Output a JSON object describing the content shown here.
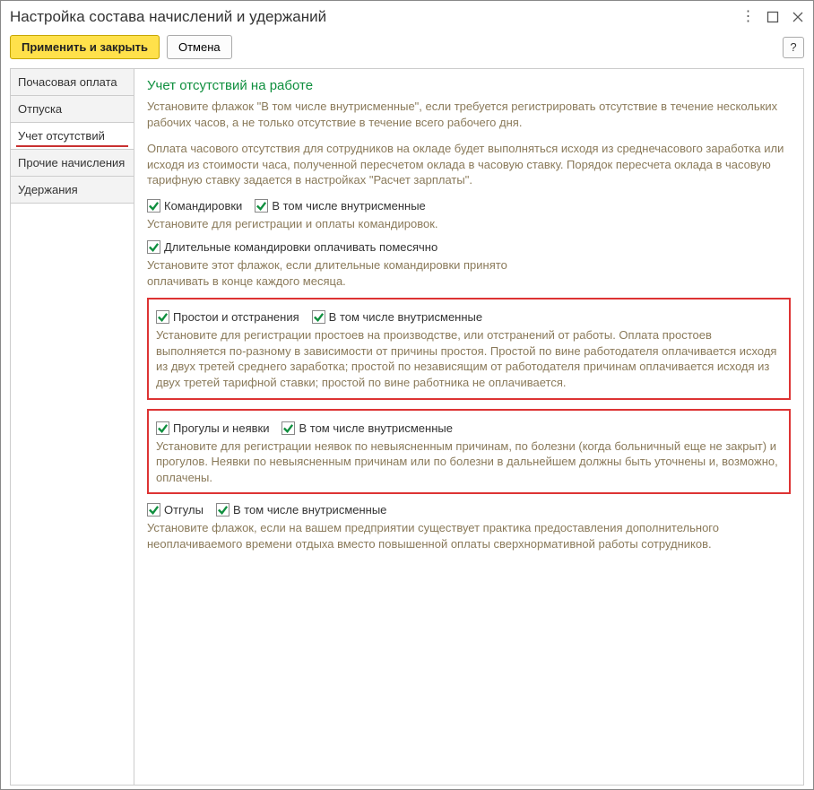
{
  "window": {
    "title": "Настройка состава начислений и удержаний"
  },
  "toolbar": {
    "apply_close": "Применить и закрыть",
    "cancel": "Отмена",
    "help": "?"
  },
  "sidebar": {
    "tabs": [
      {
        "label": "Почасовая оплата",
        "active": false
      },
      {
        "label": "Отпуска",
        "active": false
      },
      {
        "label": "Учет отсутствий",
        "active": true
      },
      {
        "label": "Прочие начисления",
        "active": false
      },
      {
        "label": "Удержания",
        "active": false
      }
    ]
  },
  "content": {
    "heading": "Учет отсутствий на работе",
    "intro1": "Установите флажок \"В том числе внутрисменные\", если требуется регистрировать отсутствие в течение нескольких рабочих часов, а не только отсутствие в течение всего рабочего дня.",
    "intro2": "Оплата часового отсутствия для сотрудников на окладе будет выполняться исходя из среднечасового заработка или исходя из стоимости часа, полученной пересчетом оклада в часовую ставку. Порядок пересчета оклада в часовую тарифную ставку задается в настройках \"Расчет зарплаты\".",
    "groups": {
      "komandirovki": {
        "label": "Командировки",
        "intra_label": "В том числе внутрисменные",
        "desc": "Установите для регистрации и оплаты командировок.",
        "long_label": "Длительные командировки оплачивать помесячно",
        "long_desc": "Установите этот флажок, если длительные командировки принято оплачивать в конце каждого месяца."
      },
      "prostoi": {
        "label": "Простои и отстранения",
        "intra_label": "В том числе внутрисменные",
        "desc": "Установите для регистрации простоев на производстве, или отстранений от работы. Оплата простоев выполняется по-разному в зависимости от причины простоя. Простой по вине работодателя оплачивается исходя из двух третей среднего заработка; простой по независящим от работодателя причинам оплачивается исходя из двух третей тарифной ставки; простой по вине работника не оплачивается."
      },
      "proguly": {
        "label": "Прогулы и неявки",
        "intra_label": "В том числе внутрисменные",
        "desc": "Установите для регистрации неявок по невыясненным причинам, по болезни (когда больничный еще не закрыт) и прогулов. Неявки по невыясненным причинам или по болезни в дальнейшем должны быть уточнены и, возможно, оплачены."
      },
      "otguly": {
        "label": "Отгулы",
        "intra_label": "В том числе внутрисменные",
        "desc": "Установите флажок, если на вашем предприятии существует практика предоставления дополнительного неоплачиваемого времени отдыха вместо повышенной оплаты сверхнормативной работы сотрудников."
      }
    }
  }
}
